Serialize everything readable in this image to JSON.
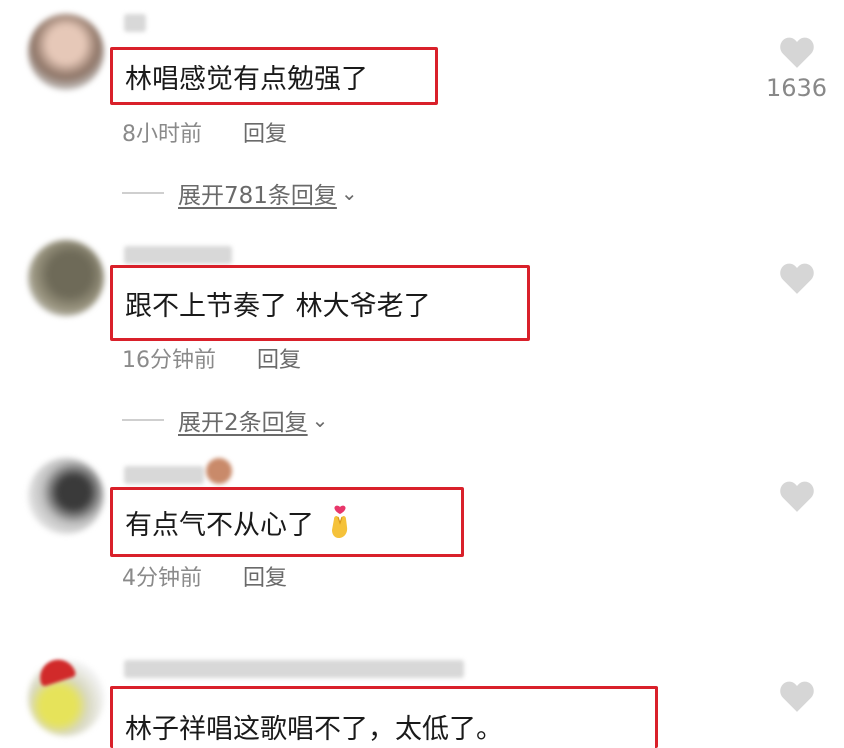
{
  "comments": [
    {
      "username": "",
      "text": "林唱感觉有点勉强了",
      "time": "8小时前",
      "reply_label": "回复",
      "expand_label": "展开781条回复",
      "likes": "1636"
    },
    {
      "username": "",
      "text": "跟不上节奏了 林大爷老了",
      "time": "16分钟前",
      "reply_label": "回复",
      "expand_label": "展开2条回复",
      "likes": ""
    },
    {
      "username": "",
      "text": "有点气不从心了",
      "emoji": "finger-heart-emoji",
      "time": "4分钟前",
      "reply_label": "回复",
      "likes": ""
    },
    {
      "username": "",
      "text": "林子祥唱这歌唱不了，太低了。",
      "likes": ""
    }
  ],
  "colors": {
    "highlight_border": "#d9202a",
    "meta_text": "#8a8a8a",
    "heart": "#d6d6d6"
  }
}
